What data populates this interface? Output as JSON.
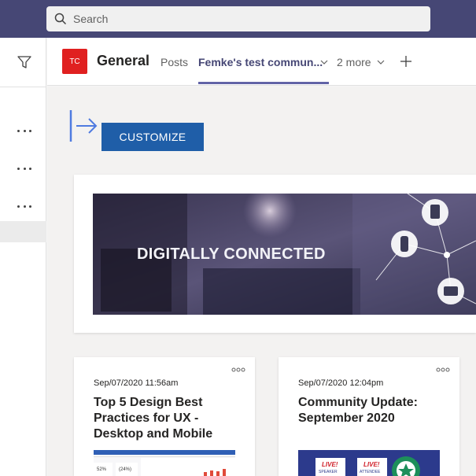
{
  "search": {
    "placeholder": "Search"
  },
  "header": {
    "avatar_initials": "TC",
    "channel_name": "General",
    "tabs": [
      {
        "label": "Posts"
      },
      {
        "label": "Femke's test commun..."
      },
      {
        "label": "2 more"
      }
    ]
  },
  "page": {
    "customize_label": "CUSTOMIZE",
    "hero_text": "DIGITALLY CONNECTED"
  },
  "cards": [
    {
      "date": "Sep/07/2020 11:56am",
      "title": "Top 5 Design Best Practices for UX - Desktop and Mobile"
    },
    {
      "date": "Sep/07/2020 12:04pm",
      "title": "Community Update: September 2020"
    }
  ],
  "thumb2": {
    "badge1": "LIVE!",
    "badge2": "LIVE!",
    "sub1": "SPEAKER",
    "sub2": "ATTENDEE"
  },
  "thumb1": {
    "stat1": "52%",
    "stat2": "(24%)"
  },
  "colors": {
    "topbar": "#464775",
    "accent": "#6264a7",
    "customize": "#1f5ea8",
    "avatar": "#e02020"
  }
}
